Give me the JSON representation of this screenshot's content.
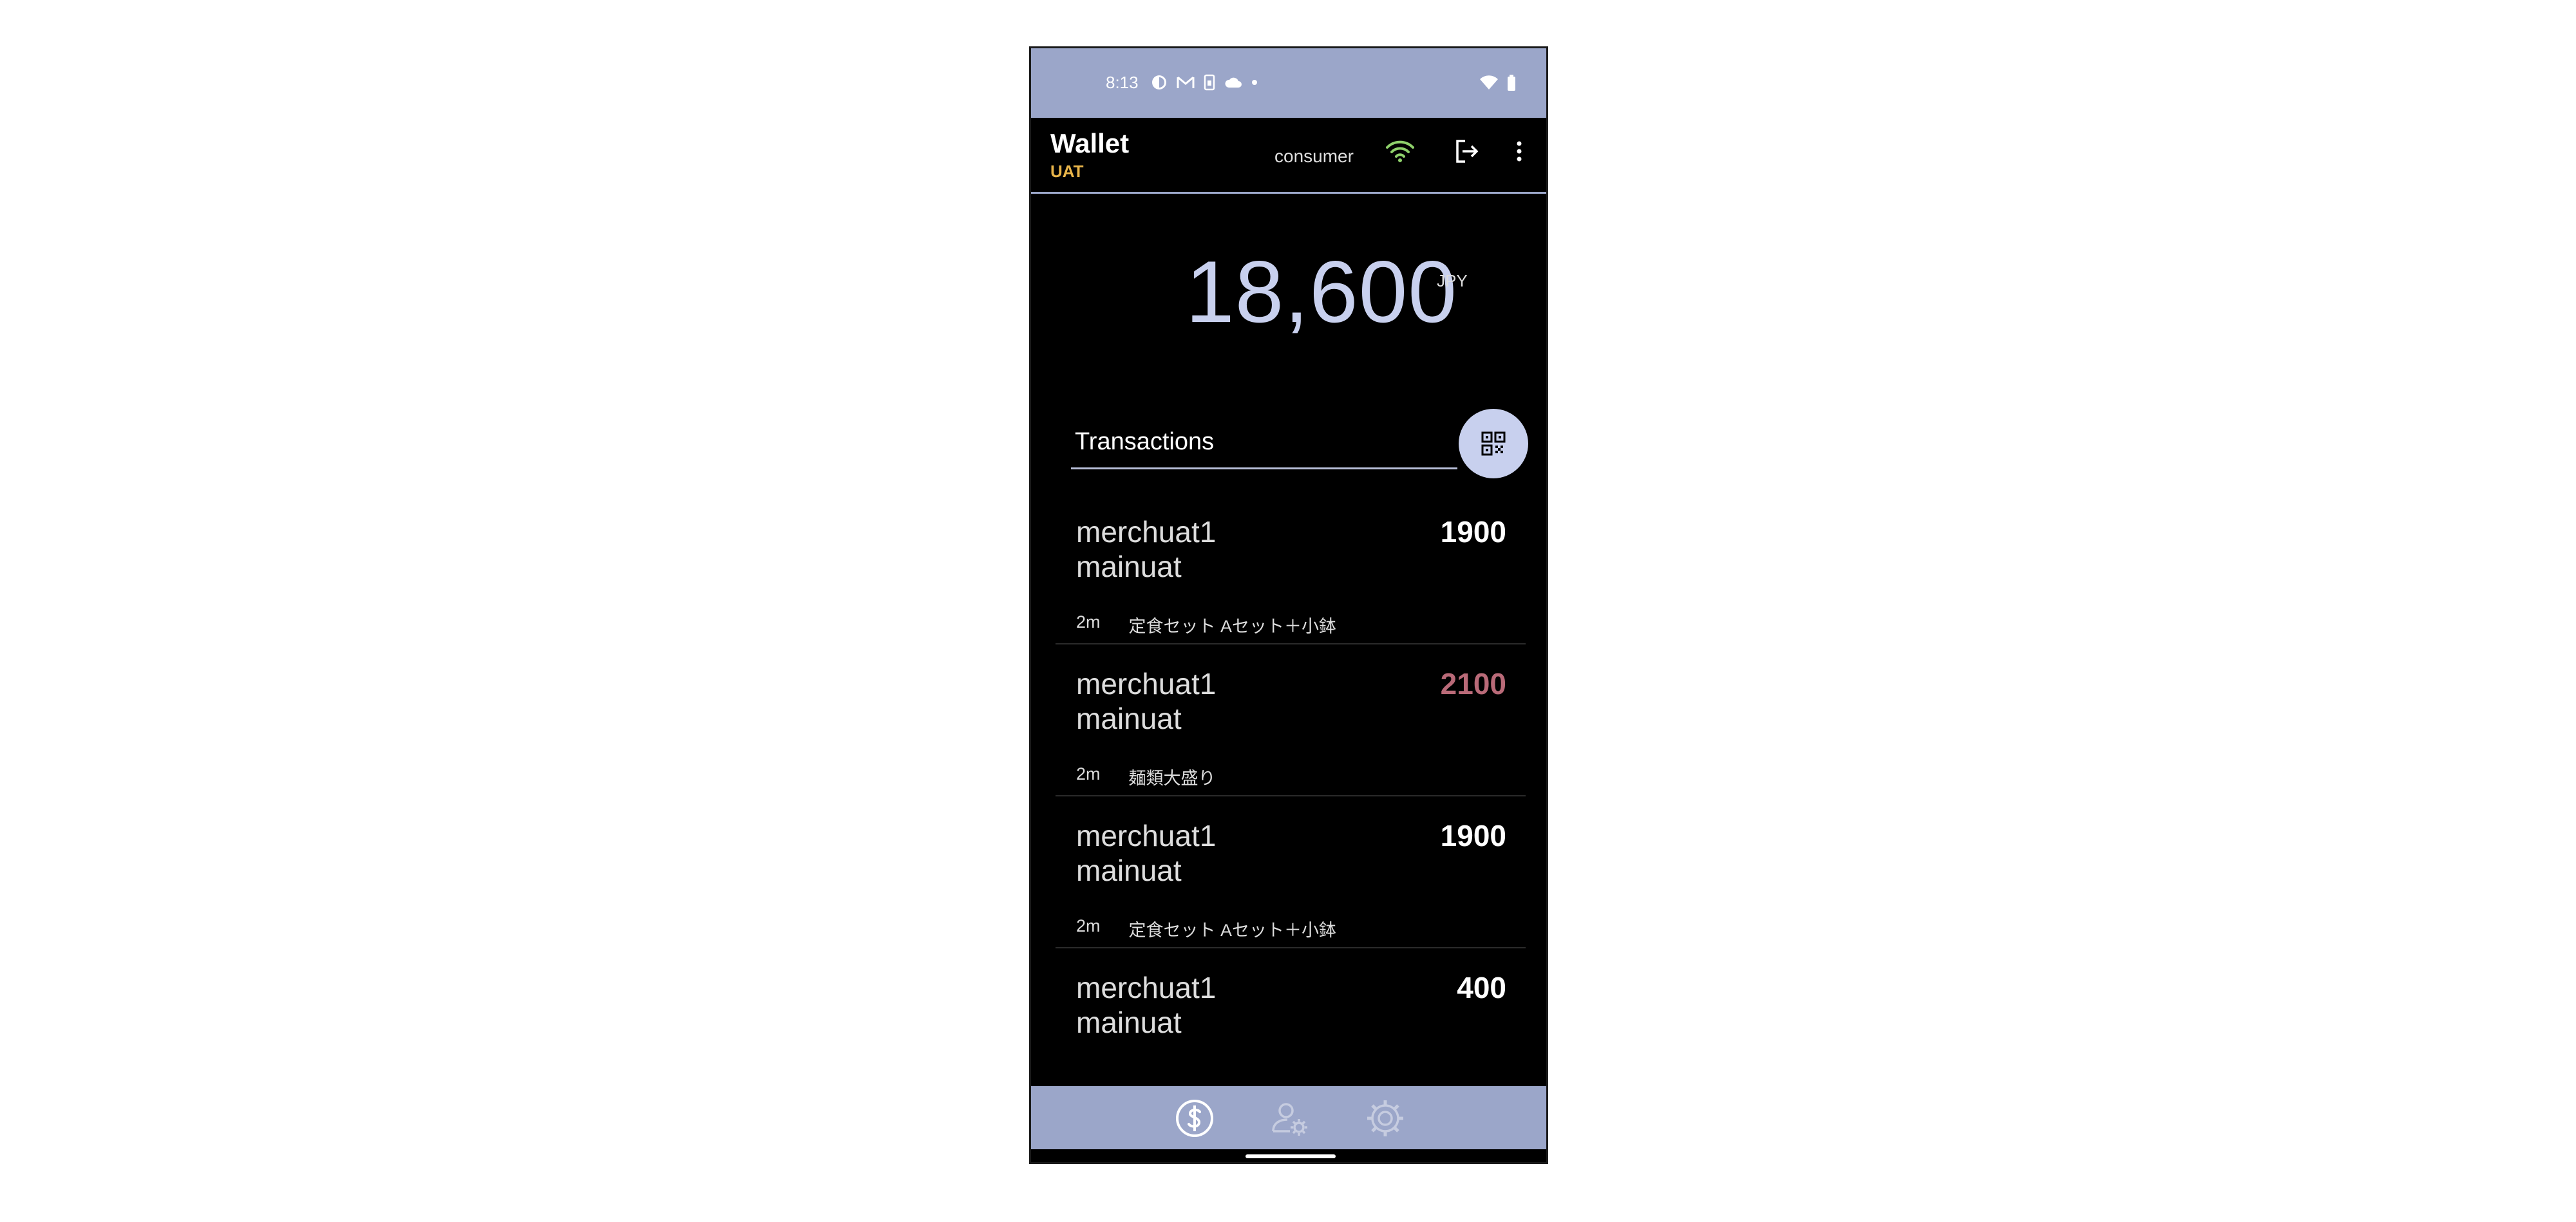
{
  "status_bar": {
    "time": "8:13",
    "left_icons": [
      "app-icon",
      "gmail-icon",
      "sim-icon",
      "cloud-icon",
      "dot-icon"
    ],
    "right_icons": [
      "wifi-icon",
      "battery-icon"
    ]
  },
  "app_bar": {
    "title": "Wallet",
    "environment": "UAT",
    "user": "consumer",
    "colors": {
      "environment": "#e9b54a",
      "connection": "#8fd16b"
    }
  },
  "balance": {
    "amount": "18,600",
    "currency": "JPY"
  },
  "transactions": {
    "header": "Transactions",
    "items": [
      {
        "merchant": "merchuat1\nmainuat",
        "amount": "1900",
        "age": "2m",
        "description": "定食セット Aセット＋小鉢",
        "highlight": false
      },
      {
        "merchant": "merchuat1\nmainuat",
        "amount": "2100",
        "age": "2m",
        "description": "麺類大盛り",
        "highlight": true
      },
      {
        "merchant": "merchuat1\nmainuat",
        "amount": "1900",
        "age": "2m",
        "description": "定食セット Aセット＋小鉢",
        "highlight": false
      },
      {
        "merchant": "merchuat1\nmainuat",
        "amount": "400",
        "age": "",
        "description": "",
        "highlight": false
      }
    ]
  },
  "bottom_nav": {
    "items": [
      {
        "name": "wallet",
        "icon": "dollar-circle-icon",
        "active": true
      },
      {
        "name": "profile-settings",
        "icon": "user-gear-icon",
        "active": false
      },
      {
        "name": "settings",
        "icon": "gear-icon",
        "active": false
      }
    ]
  },
  "theme": {
    "accent": "#9ba6c9",
    "balance": "#c8d0ee",
    "negative_amount": "#b96a78"
  }
}
